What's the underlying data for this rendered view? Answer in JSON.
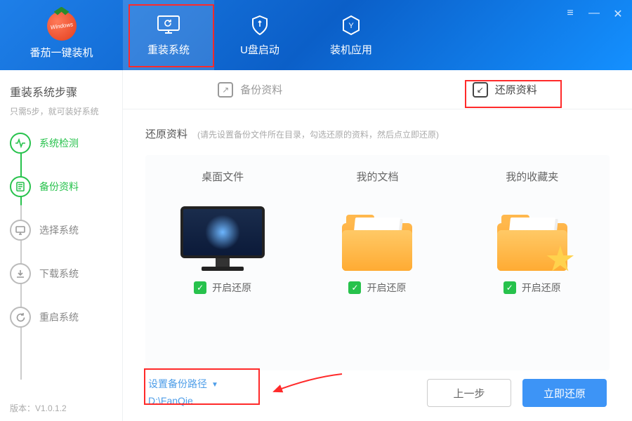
{
  "app": {
    "title": "番茄一键装机",
    "logo_text": "Windows"
  },
  "nav": [
    {
      "label": "重装系统",
      "active": true
    },
    {
      "label": "U盘启动",
      "active": false
    },
    {
      "label": "装机应用",
      "active": false
    }
  ],
  "sidebar": {
    "title": "重装系统步骤",
    "subtitle": "只需5步，就可装好系统",
    "steps": [
      {
        "label": "系统检测",
        "state": "done"
      },
      {
        "label": "备份资料",
        "state": "done"
      },
      {
        "label": "选择系统",
        "state": "todo"
      },
      {
        "label": "下载系统",
        "state": "todo"
      },
      {
        "label": "重启系统",
        "state": "todo"
      }
    ],
    "version": "版本：V1.0.1.2"
  },
  "sub_tabs": [
    {
      "label": "备份资料",
      "active": false
    },
    {
      "label": "还原资料",
      "active": true
    }
  ],
  "section": {
    "title": "还原资料",
    "hint": "(请先设置备份文件所在目录，勾选还原的资料，然后点立即还原)"
  },
  "cards": [
    {
      "title": "桌面文件",
      "toggle": "开启还原"
    },
    {
      "title": "我的文档",
      "toggle": "开启还原"
    },
    {
      "title": "我的收藏夹",
      "toggle": "开启还原"
    }
  ],
  "path": {
    "label": "设置备份路径",
    "value": "D:\\FanQie"
  },
  "buttons": {
    "prev": "上一步",
    "restore": "立即还原"
  }
}
